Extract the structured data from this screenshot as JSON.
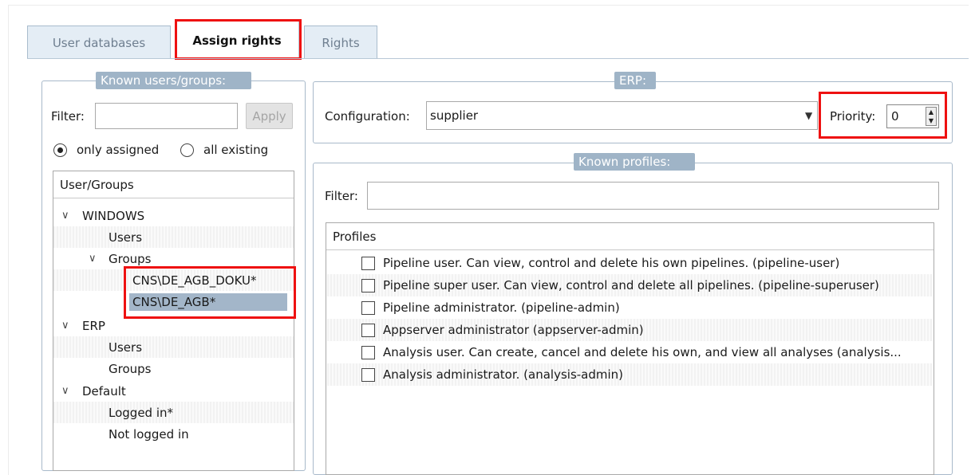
{
  "tabs": [
    {
      "label": "User databases",
      "active": false
    },
    {
      "label": "Assign rights",
      "active": true
    },
    {
      "label": "Rights",
      "active": false
    }
  ],
  "left_panel": {
    "legend": "Known users/groups:",
    "filter_label": "Filter:",
    "filter_value": "",
    "apply_label": "Apply",
    "radio_only_assigned": "only assigned",
    "radio_all_existing": "all existing",
    "tree_header": "User/Groups",
    "tree": [
      {
        "label": "WINDOWS",
        "expanded": true
      },
      {
        "label": "Users"
      },
      {
        "label": "Groups",
        "expanded": true
      },
      {
        "label": "CNS\\DE_AGB_DOKU*"
      },
      {
        "label": "CNS\\DE_AGB*",
        "selected": true
      },
      {
        "label": "ERP",
        "expanded": true
      },
      {
        "label": "Users"
      },
      {
        "label": "Groups"
      },
      {
        "label": "Default",
        "expanded": true
      },
      {
        "label": "Logged in*"
      },
      {
        "label": "Not logged in"
      }
    ]
  },
  "erp_panel": {
    "legend": "ERP:",
    "configuration_label": "Configuration:",
    "configuration_value": "supplier",
    "priority_label": "Priority:",
    "priority_value": "0"
  },
  "profiles_panel": {
    "legend": "Known profiles:",
    "filter_label": "Filter:",
    "filter_value": "",
    "list_header": "Profiles",
    "items": [
      "Pipeline user. Can view, control and delete his own pipelines. (pipeline-user)",
      "Pipeline super user. Can view, control and delete all pipelines. (pipeline-superuser)",
      "Pipeline administrator. (pipeline-admin)",
      "Appserver administrator (appserver-admin)",
      "Analysis user. Can create, cancel and delete his own, and view all analyses (analysis...",
      "Analysis administrator. (analysis-admin)"
    ]
  },
  "colors": {
    "highlight": "#ee1111",
    "legend_bg": "#9fb4c7",
    "selection": "#a3b6c9"
  },
  "icons": {
    "tree_expand": "chevron-down-icon",
    "combo_dropdown": "dropdown-arrow-icon",
    "spinner": "spin-up-down-icon"
  }
}
